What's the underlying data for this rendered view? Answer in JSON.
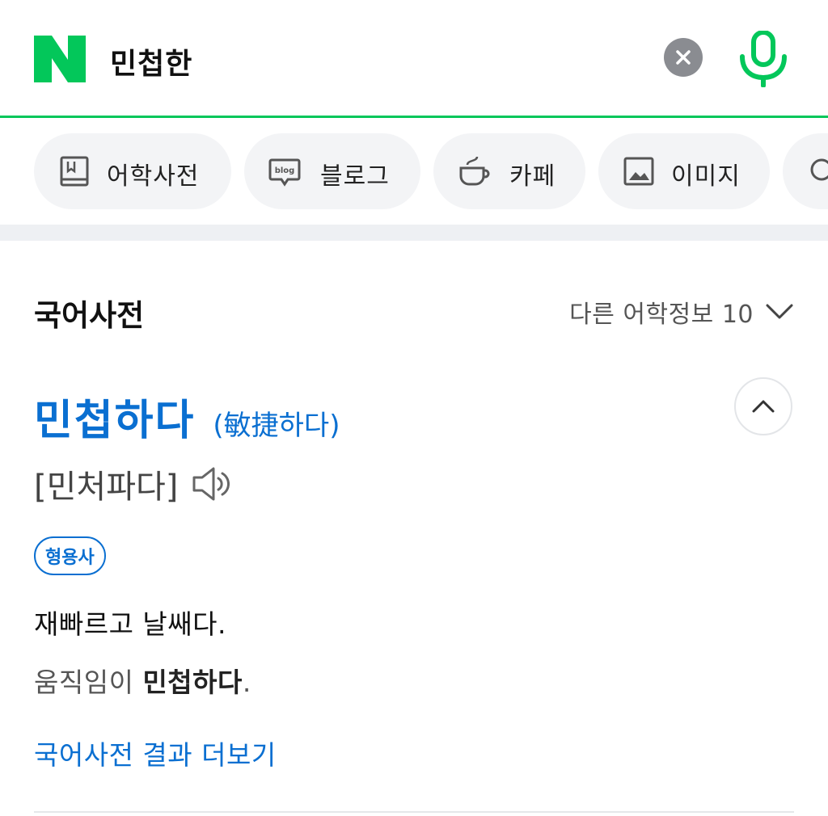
{
  "header": {
    "logo_text": "N",
    "query": "민첩한",
    "brand_color": "#03c75a",
    "clear_icon": "close-icon",
    "mic_icon": "microphone-icon"
  },
  "chips": [
    {
      "label": "어학사전",
      "icon": "dictionary-icon"
    },
    {
      "label": "블로그",
      "icon": "blog-icon"
    },
    {
      "label": "카페",
      "icon": "cafe-icon"
    },
    {
      "label": "이미지",
      "icon": "image-icon"
    },
    {
      "label": "",
      "icon": "search-icon"
    }
  ],
  "dictionary": {
    "section_title": "국어사전",
    "other_info": "다른 어학정보 10",
    "word": "민첩하다",
    "hanja": "(敏捷하다)",
    "pronunciation": "[민처파다]",
    "part_of_speech": "형용사",
    "definition": "재빠르고 날쌔다.",
    "example_before": "움직임이 ",
    "example_bold": "민첩하다",
    "example_after": ".",
    "more_link": "국어사전 결과 더보기",
    "accent_color": "#0a6fd1"
  }
}
